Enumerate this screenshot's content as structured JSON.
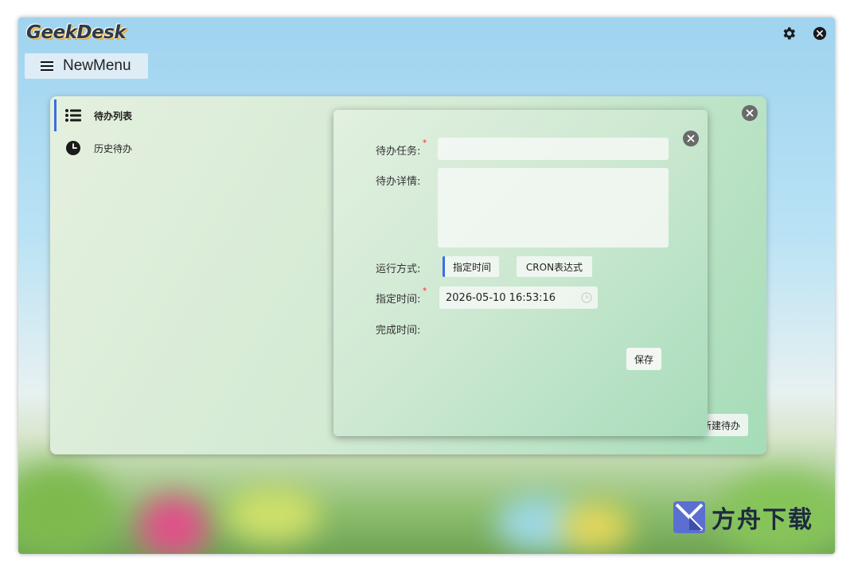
{
  "app": {
    "logo_text": "GeekDesk"
  },
  "topbar": {
    "settings_icon": "gear-icon",
    "close_icon": "close-circle-icon"
  },
  "new_menu": {
    "label": "NewMenu",
    "icon": "hamburger-icon"
  },
  "todo_panel": {
    "menu": [
      {
        "label": "待办列表",
        "icon": "list-icon",
        "active": true
      },
      {
        "label": "历史待办",
        "icon": "clock-icon",
        "active": false
      }
    ],
    "new_todo_label": "新建待办"
  },
  "dialog": {
    "task_label": "待办任务:",
    "task_value": "",
    "detail_label": "待办详情:",
    "detail_value": "",
    "run_mode_label": "运行方式:",
    "run_modes": [
      "指定时间",
      "CRON表达式"
    ],
    "selected_mode": "指定时间",
    "time_label": "指定时间:",
    "time_value": "2026-05-10 16:53:16",
    "finish_label": "完成时间:",
    "required_mark": "*",
    "save_label": "保存"
  },
  "watermark": {
    "text": "方舟下载"
  },
  "colors": {
    "accent": "#3b6fe0",
    "required": "#e23b3b"
  }
}
